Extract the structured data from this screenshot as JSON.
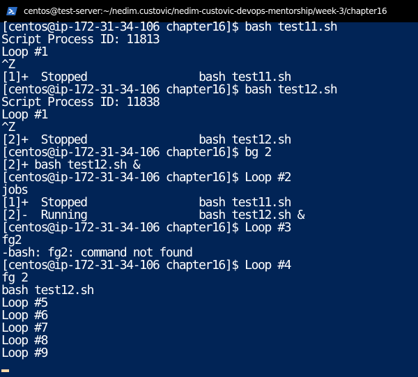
{
  "window": {
    "title": "centos@test-server:~/nedim.custovic/nedim-custovic-devops-mentorship/week-3/chapter16",
    "icon": "powershell-icon"
  },
  "colors": {
    "background": "#012456",
    "text": "#ffffff",
    "titlebar": "#000000",
    "cursor": "#ffd9a8"
  },
  "terminal": {
    "lines": [
      "[centos@ip-172-31-34-106 chapter16]$ bash test11.sh",
      "Script Process ID: 11813",
      "Loop #1",
      "^Z",
      "[1]+  Stopped                 bash test11.sh",
      "[centos@ip-172-31-34-106 chapter16]$ bash test12.sh",
      "Script Process ID: 11838",
      "Loop #1",
      "^Z",
      "[2]+  Stopped                 bash test12.sh",
      "[centos@ip-172-31-34-106 chapter16]$ bg 2",
      "[2]+ bash test12.sh &",
      "[centos@ip-172-31-34-106 chapter16]$ Loop #2",
      "jobs",
      "[1]+  Stopped                 bash test11.sh",
      "[2]-  Running                 bash test12.sh &",
      "[centos@ip-172-31-34-106 chapter16]$ Loop #3",
      "fg2",
      "-bash: fg2: command not found",
      "[centos@ip-172-31-34-106 chapter16]$ Loop #4",
      "fg 2",
      "bash test12.sh",
      "Loop #5",
      "Loop #6",
      "Loop #7",
      "Loop #8",
      "Loop #9"
    ]
  }
}
